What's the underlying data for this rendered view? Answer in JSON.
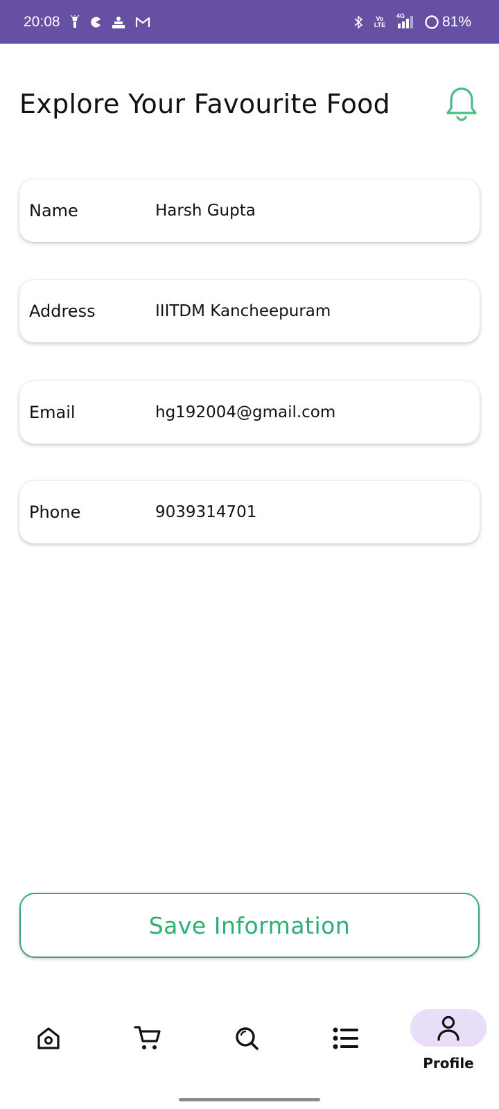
{
  "status_bar": {
    "time": "20:08",
    "battery": "81%",
    "network": "4G",
    "volte": "Vo LTE",
    "icons": [
      "flashlight-icon",
      "pacman-icon",
      "news-icon",
      "gmail-icon",
      "bluetooth-icon",
      "volte-icon",
      "signal-icon",
      "battery-icon"
    ]
  },
  "header": {
    "title": "Explore Your Favourite Food",
    "bell_icon": "bell-icon",
    "accent": "#4cbb87"
  },
  "profile": {
    "fields": [
      {
        "label": "Name",
        "value": "Harsh Gupta"
      },
      {
        "label": "Address",
        "value": "IIITDM Kancheepuram"
      },
      {
        "label": "Email",
        "value": "hg192004@gmail.com"
      },
      {
        "label": "Phone",
        "value": "9039314701"
      }
    ]
  },
  "save_button": {
    "label": "Save Information",
    "color": "#2eae73"
  },
  "bottom_nav": {
    "items": [
      {
        "icon": "home-icon"
      },
      {
        "icon": "cart-icon"
      },
      {
        "icon": "search-icon"
      },
      {
        "icon": "list-icon"
      },
      {
        "icon": "profile-icon",
        "label": "Profile",
        "active": true
      }
    ],
    "active_pill_color": "#e8def8"
  }
}
